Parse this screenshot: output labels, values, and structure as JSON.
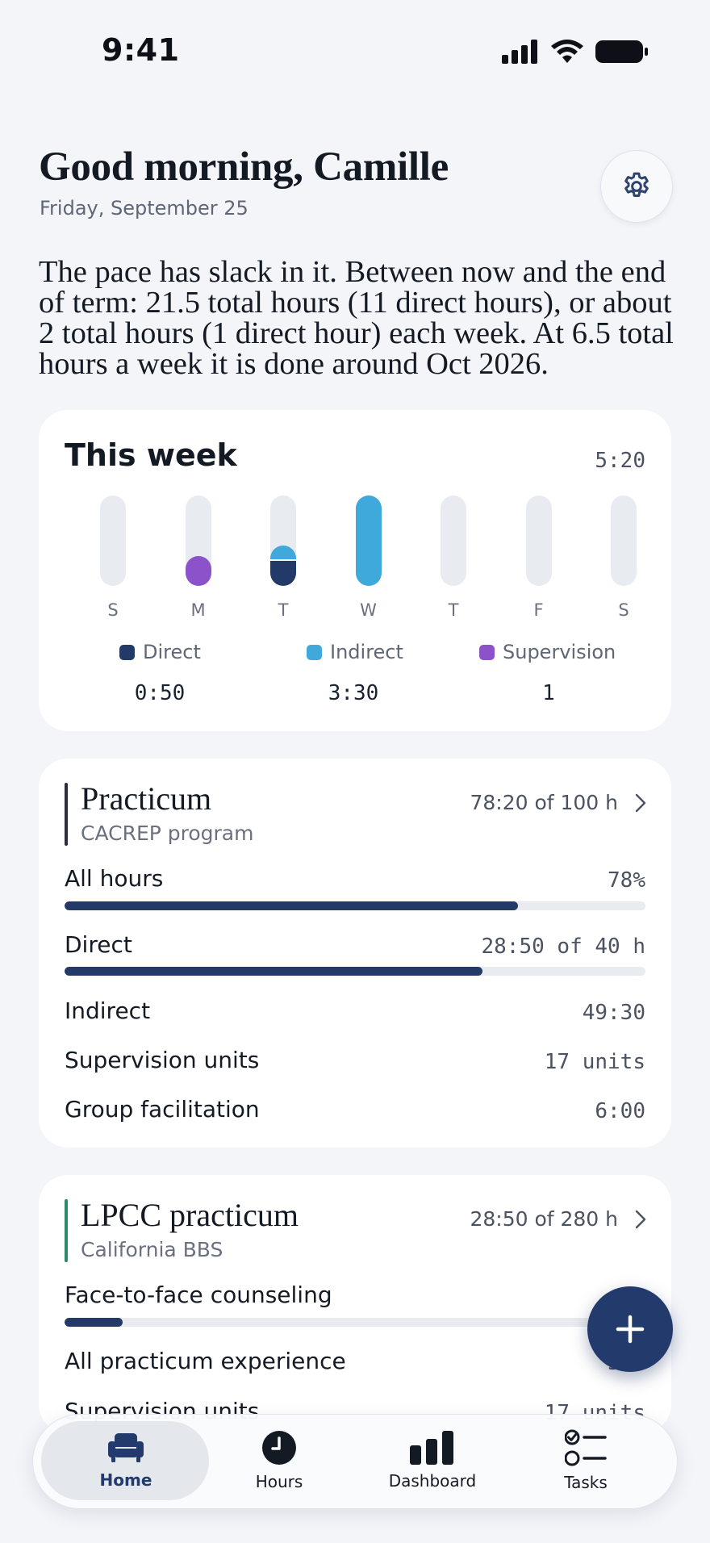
{
  "status": {
    "time": "9:41"
  },
  "header": {
    "greeting": "Good morning, Camille",
    "date": "Friday, September 25"
  },
  "pace_text": "The pace has slack in it. Between now and the end of term: 21.5 total hours (11 direct hours), or about 2 total hours (1 direct hour) each week. At 6.5 total hours a week it is done around Oct 2026.",
  "week": {
    "title": "This week",
    "total": "5:20",
    "days": [
      {
        "label": "S",
        "direct": 0,
        "indirect": 0,
        "supervision": 0
      },
      {
        "label": "M",
        "direct": 0,
        "indirect": 0,
        "supervision": 0.33
      },
      {
        "label": "T",
        "direct": 0.28,
        "indirect": 0.17,
        "supervision": 0
      },
      {
        "label": "W",
        "direct": 0,
        "indirect": 1.0,
        "supervision": 0
      },
      {
        "label": "T",
        "direct": 0,
        "indirect": 0,
        "supervision": 0
      },
      {
        "label": "F",
        "direct": 0,
        "indirect": 0,
        "supervision": 0
      },
      {
        "label": "S",
        "direct": 0,
        "indirect": 0,
        "supervision": 0
      }
    ],
    "legend": [
      {
        "name": "Direct",
        "value": "0:50",
        "color": "#233a68"
      },
      {
        "name": "Indirect",
        "value": "3:30",
        "color": "#3fa9dc"
      },
      {
        "name": "Supervision",
        "value": "1",
        "color": "#8b52c9"
      }
    ]
  },
  "programs": [
    {
      "name": "Practicum",
      "subtitle": "CACREP program",
      "total": "78:20 of 100 h",
      "accent": "#2b2f3a",
      "rows": [
        {
          "label": "All hours",
          "value": "78%",
          "progress": 0.78
        },
        {
          "label": "Direct",
          "value": "28:50 of 40 h",
          "progress": 0.72
        },
        {
          "label": "Indirect",
          "value": "49:30"
        },
        {
          "label": "Supervision units",
          "value": "17 units"
        },
        {
          "label": "Group facilitation",
          "value": "6:00"
        }
      ]
    },
    {
      "name": "LPCC practicum",
      "subtitle": "California BBS",
      "total": "28:50 of 280 h",
      "accent": "#2e8b6a",
      "rows": [
        {
          "label": "Face-to-face counseling",
          "value": "",
          "progress": 0.1
        },
        {
          "label": "All practicum experience",
          "value": "59%"
        },
        {
          "label": "Supervision units",
          "value": "17 units"
        }
      ]
    }
  ],
  "tabs": [
    {
      "label": "Home",
      "icon": "armchair-icon",
      "active": true
    },
    {
      "label": "Hours",
      "icon": "clock-icon"
    },
    {
      "label": "Dashboard",
      "icon": "bar-chart-icon"
    },
    {
      "label": "Tasks",
      "icon": "checklist-icon"
    }
  ],
  "fab_icon": "plus-icon"
}
